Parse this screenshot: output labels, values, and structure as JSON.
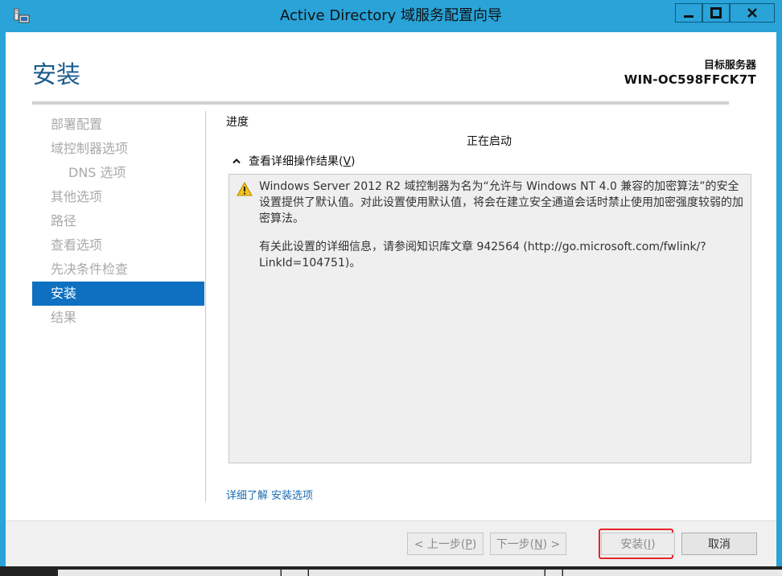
{
  "window": {
    "title": "Active Directory 域服务配置向导",
    "icons": {
      "app": "server-wizard-icon",
      "minimize": "minimize-icon",
      "maximize": "maximize-icon",
      "close": "close-icon"
    }
  },
  "header": {
    "page_title": "安装",
    "target_label": "目标服务器",
    "target_server": "WIN-OC598FFCK7T"
  },
  "sidebar": {
    "items": [
      {
        "label": "部署配置",
        "state": "disabled"
      },
      {
        "label": "域控制器选项",
        "state": "disabled"
      },
      {
        "label": "DNS 选项",
        "state": "disabled",
        "indent": true
      },
      {
        "label": "其他选项",
        "state": "disabled"
      },
      {
        "label": "路径",
        "state": "disabled"
      },
      {
        "label": "查看选项",
        "state": "disabled"
      },
      {
        "label": "先决条件检查",
        "state": "disabled"
      },
      {
        "label": "安装",
        "state": "active"
      },
      {
        "label": "结果",
        "state": "disabled"
      }
    ]
  },
  "main": {
    "progress_label": "进度",
    "status_text": "正在启动",
    "details_toggle": {
      "prefix": "查看详细操作结果(",
      "accelerator": "V",
      "suffix": ")",
      "icon": "chevron-up-icon"
    },
    "details": {
      "icon": "warning-icon",
      "paragraph1": "Windows Server 2012 R2 域控制器为名为“允许与 Windows NT 4.0 兼容的加密算法”的安全设置提供了默认值。对此设置使用默认值，将会在建立安全通道会话时禁止使用加密强度较弱的加密算法。",
      "paragraph2": "有关此设置的详细信息，请参阅知识库文章 942564 (http://go.microsoft.com/fwlink/?LinkId=104751)。"
    },
    "learn_more": {
      "prefix": "详细了解",
      "link": "安装选项"
    }
  },
  "footer": {
    "prev": {
      "prefix": "< 上一步(",
      "accelerator": "P",
      "suffix": ")"
    },
    "next": {
      "prefix": "下一步(",
      "accelerator": "N",
      "suffix": ") >"
    },
    "install": {
      "prefix": "安装(",
      "accelerator": "I",
      "suffix": ")"
    },
    "cancel": "取消"
  },
  "colors": {
    "titlebar": "#29a3d8",
    "page_title": "#1c5d8c",
    "nav_active": "#0e70c0",
    "link": "#1a6ab3",
    "highlight_ring": "#e8242a"
  }
}
